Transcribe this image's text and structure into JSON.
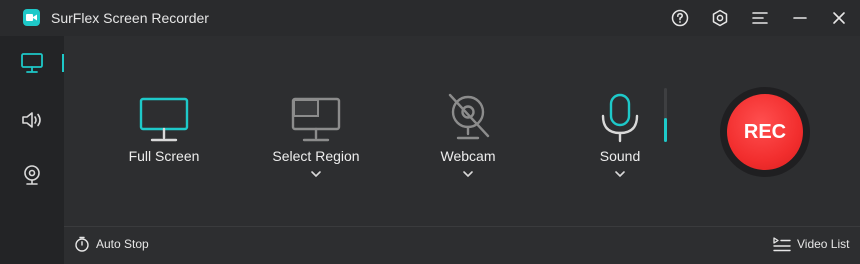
{
  "window": {
    "title": "SurFlex Screen Recorder"
  },
  "titlebar": {
    "icons": [
      "help-icon",
      "settings-icon",
      "menu-icon",
      "minimize-icon",
      "close-icon"
    ]
  },
  "sidebar": {
    "items": [
      {
        "icon": "monitor-icon",
        "active": true
      },
      {
        "icon": "speaker-icon",
        "active": false
      },
      {
        "icon": "webcam-icon",
        "active": false
      }
    ]
  },
  "options": [
    {
      "label": "Full Screen",
      "icon": "monitor-icon",
      "active": true,
      "has_dropdown": false
    },
    {
      "label": "Select Region",
      "icon": "region-icon",
      "active": false,
      "has_dropdown": true
    },
    {
      "label": "Webcam",
      "icon": "webcam-off-icon",
      "active": false,
      "has_dropdown": true
    },
    {
      "label": "Sound",
      "icon": "microphone-icon",
      "active": true,
      "has_dropdown": true
    }
  ],
  "sound_level": 0.45,
  "rec_label": "REC",
  "bottom": {
    "auto_stop_label": "Auto Stop",
    "video_list_label": "Video List"
  },
  "colors": {
    "accent": "#1ec9c9",
    "rec": "#f22e2e",
    "background": "#2d2e30"
  }
}
